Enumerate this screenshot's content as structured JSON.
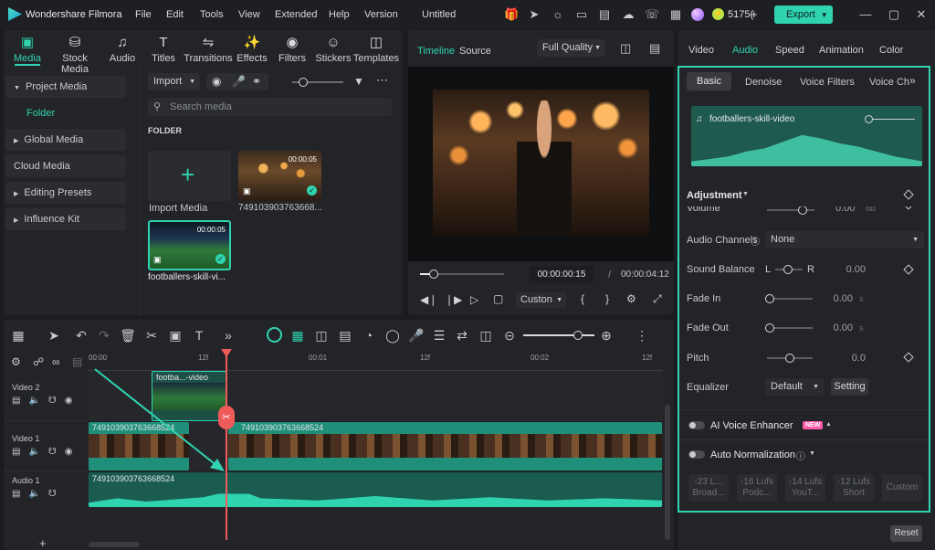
{
  "app": {
    "name": "Wondershare Filmora",
    "project_title": "Untitled",
    "credits": "5175(",
    "export_label": "Export"
  },
  "menu": [
    "File",
    "Edit",
    "Tools",
    "View",
    "Extended",
    "Help",
    "Version"
  ],
  "media_tabs": [
    {
      "label": "Media",
      "icon": "media-icon"
    },
    {
      "label": "Stock Media",
      "icon": "stock-media-icon"
    },
    {
      "label": "Audio",
      "icon": "music-note-icon"
    },
    {
      "label": "Titles",
      "icon": "titles-icon"
    },
    {
      "label": "Transitions",
      "icon": "transitions-icon"
    },
    {
      "label": "Effects",
      "icon": "effects-icon"
    },
    {
      "label": "Filters",
      "icon": "filters-icon"
    },
    {
      "label": "Stickers",
      "icon": "stickers-icon"
    },
    {
      "label": "Templates",
      "icon": "templates-icon"
    }
  ],
  "sidebar": {
    "project_media": "Project Media",
    "folder": "Folder",
    "items": [
      "Global Media",
      "Cloud Media",
      "Editing Presets",
      "Influence Kit"
    ]
  },
  "media_panel": {
    "import_label": "Import",
    "search_placeholder": "Search media",
    "folder_heading": "FOLDER",
    "import_media_label": "Import Media",
    "clips": [
      {
        "name": "749103903763668...",
        "duration": "00:00:05"
      },
      {
        "name": "footballers-skill-vi...",
        "duration": "00:00:05"
      }
    ]
  },
  "player": {
    "tabs": [
      "Timeline",
      "Source"
    ],
    "quality": "Full Quality",
    "current_time": "00:00:00:15",
    "total_time": "00:00:04:12",
    "custom_label": "Custon",
    "progress": 0.15
  },
  "timeline": {
    "ruler": [
      "00:00",
      "12f",
      "00:01",
      "12f",
      "00:02",
      "12f"
    ],
    "tracks": [
      {
        "name": "Video 2"
      },
      {
        "name": "Video 1"
      },
      {
        "name": "Audio 1"
      }
    ],
    "clips": {
      "v2": "footba...-video",
      "v1_a": "749103903763668524",
      "v1_b": "749103903763668524",
      "a1": "749103903763668524"
    }
  },
  "properties": {
    "top_tabs": [
      "Video",
      "Audio",
      "Speed",
      "Animation",
      "Color"
    ],
    "sub_tabs": [
      "Basic",
      "Denoise",
      "Voice Filters",
      "Voice Ch"
    ],
    "clip_name": "footballers-skill-video",
    "adjustment": "Adjustment",
    "volume_label": "Volume",
    "volume_value": "0.00",
    "volume_unit": "dB",
    "audio_channels_label": "Audio Channels",
    "audio_channels_value": "None",
    "sound_balance_label": "Sound Balance",
    "balance_l": "L",
    "balance_r": "R",
    "sound_balance_value": "0.00",
    "fade_in_label": "Fade In",
    "fade_in_value": "0.00",
    "fade_out_label": "Fade Out",
    "fade_out_value": "0.00",
    "sec_unit": "s",
    "pitch_label": "Pitch",
    "pitch_value": "0.0",
    "equalizer_label": "Equalizer",
    "equalizer_value": "Default",
    "setting_label": "Setting",
    "ai_voice_label": "AI Voice Enhancer",
    "new_badge": "NEW",
    "auto_norm_label": "Auto Normalization",
    "presets": [
      {
        "l1": "-23 L...",
        "l2": "Broad..."
      },
      {
        "l1": "-16 Lufs",
        "l2": "Podc..."
      },
      {
        "l1": "-14 Lufs",
        "l2": "YouT..."
      },
      {
        "l1": "-12 Lufs",
        "l2": "Short"
      },
      {
        "l1": "Custom",
        "l2": ""
      }
    ],
    "reset_label": "Reset"
  },
  "colors": {
    "accent": "#2fd3b0",
    "playhead": "#ef5a5a",
    "clip": "#1f8f7a"
  }
}
